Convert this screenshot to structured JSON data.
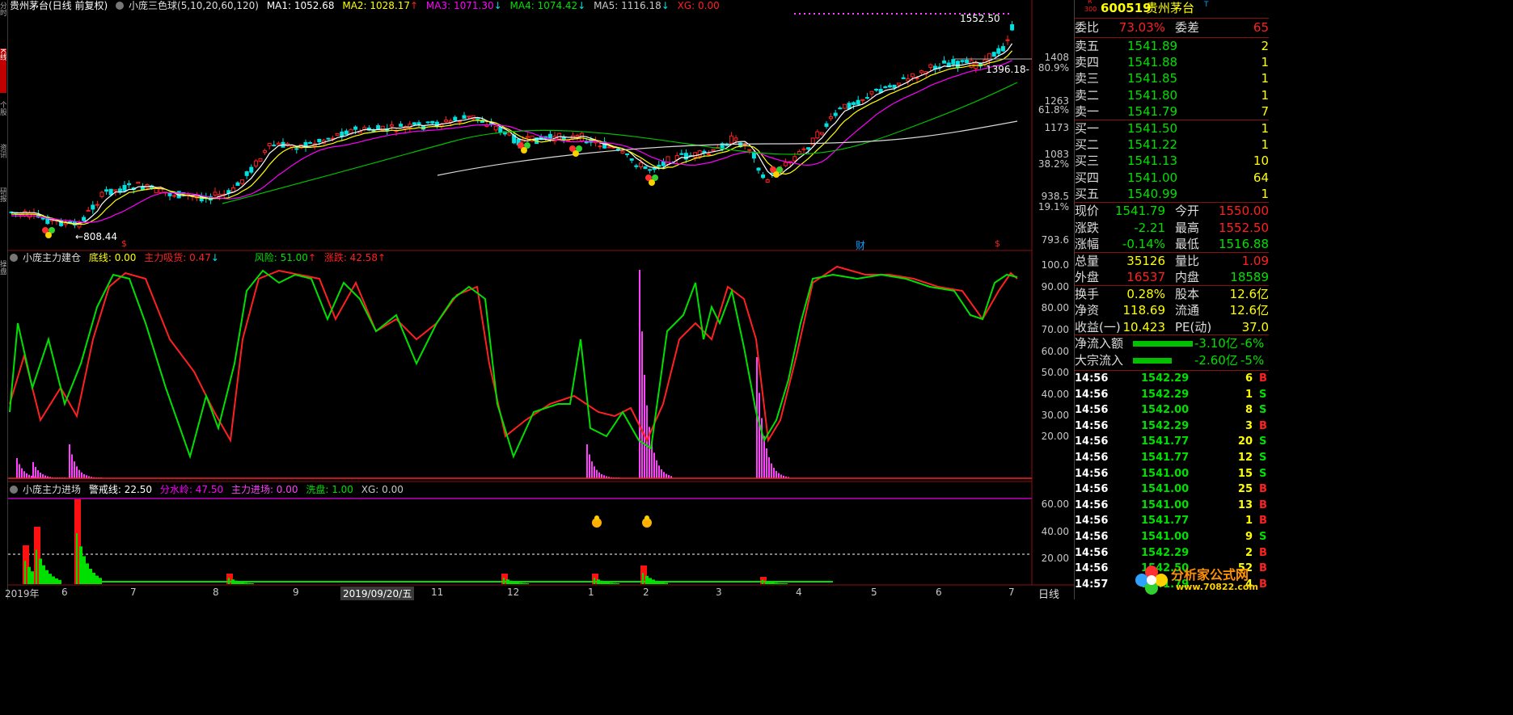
{
  "colors": {
    "up": "#ff2020",
    "down": "#00e0e0",
    "green": "#00e000",
    "yellow": "#ffff00",
    "pink": "#ff40ff",
    "magenta": "#ff00ff",
    "white": "#ffffff",
    "grey": "#c8c8c8",
    "teal": "#00a0a0"
  },
  "sidebar": {
    "tabs": [
      {
        "label": "分时",
        "icon": ""
      },
      {
        "label": "K线",
        "icon": ""
      },
      {
        "label": "个股",
        "icon": ""
      },
      {
        "label": "资讯",
        "icon": ""
      },
      {
        "label": "研报",
        "icon": ""
      },
      {
        "label": "操盘",
        "icon": ""
      }
    ]
  },
  "main": {
    "header": {
      "title": "贵州茅台(日线 前复权)",
      "indicator": "小庞三色球(5,10,20,60,120)",
      "ma1": "MA1: 1052.68",
      "ma2": "MA2: 1028.17",
      "ma3": "MA3: 1071.30",
      "ma4": "MA4: 1074.42",
      "ma5": "MA5: 1116.18",
      "xg": "XG: 0.00"
    },
    "price_axis": [
      "1408",
      "80.9%",
      "1263",
      "61.8%",
      "1173",
      "1083",
      "38.2%",
      "938.5",
      "19.1%",
      "793.6"
    ],
    "annotations": {
      "high": "1552.50",
      "low": "808.44",
      "mid": "1396.18"
    },
    "markers": {
      "fin": "财",
      "div": "$"
    }
  },
  "panel1": {
    "header": {
      "name": "小庞主力建仓",
      "a": "底线: 0.00",
      "b": "主力吸货: 0.47",
      "c": "风险: 51.00",
      "d": "涨跌: 42.58"
    },
    "axis": [
      "100.0",
      "90.00",
      "80.00",
      "70.00",
      "60.00",
      "50.00",
      "40.00",
      "30.00",
      "20.00"
    ]
  },
  "panel2": {
    "header": {
      "name": "小庞主力进场",
      "a": "警戒线: 22.50",
      "b": "分水岭: 47.50",
      "c": "主力进场: 0.00",
      "d": "洗盘: 1.00",
      "e": "XG: 0.00"
    },
    "axis": [
      "60.00",
      "40.00",
      "20.00"
    ]
  },
  "xaxis": {
    "labels": [
      "2019年",
      "6",
      "7",
      "8",
      "9",
      "2019/09/20/五",
      "11",
      "12",
      "1",
      "2",
      "3",
      "4",
      "5",
      "6",
      "7"
    ],
    "period": "日线"
  },
  "quote": {
    "code": "600519",
    "name": "贵州茅台",
    "prefix_r": "R",
    "prefix_300": "300",
    "suffix_t": "T",
    "weibi_label": "委比",
    "weibi": "73.03%",
    "weicha_label": "委差",
    "weicha": "65",
    "asks": [
      {
        "label": "卖五",
        "price": "1541.89",
        "vol": "2"
      },
      {
        "label": "卖四",
        "price": "1541.88",
        "vol": "1"
      },
      {
        "label": "卖三",
        "price": "1541.85",
        "vol": "1"
      },
      {
        "label": "卖二",
        "price": "1541.80",
        "vol": "1"
      },
      {
        "label": "卖一",
        "price": "1541.79",
        "vol": "7"
      }
    ],
    "bids": [
      {
        "label": "买一",
        "price": "1541.50",
        "vol": "1"
      },
      {
        "label": "买二",
        "price": "1541.22",
        "vol": "1"
      },
      {
        "label": "买三",
        "price": "1541.13",
        "vol": "10"
      },
      {
        "label": "买四",
        "price": "1541.00",
        "vol": "64"
      },
      {
        "label": "买五",
        "price": "1540.99",
        "vol": "1"
      }
    ],
    "stats": [
      {
        "l1": "现价",
        "v1": "1541.79",
        "l2": "今开",
        "v2": "1550.00"
      },
      {
        "l1": "涨跌",
        "v1": "-2.21",
        "l2": "最高",
        "v2": "1552.50"
      },
      {
        "l1": "涨幅",
        "v1": "-0.14%",
        "l2": "最低",
        "v2": "1516.88"
      },
      {
        "l1": "总量",
        "v1": "35126",
        "l2": "量比",
        "v2": "1.09"
      },
      {
        "l1": "外盘",
        "v1": "16537",
        "l2": "内盘",
        "v2": "18589"
      },
      {
        "l1": "换手",
        "v1": "0.28%",
        "l2": "股本",
        "v2": "12.6亿"
      },
      {
        "l1": "净资",
        "v1": "118.69",
        "l2": "流通",
        "v2": "12.6亿"
      },
      {
        "l1": "收益(一)",
        "v1": "10.423",
        "l2": "PE(动)",
        "v2": "37.0"
      }
    ],
    "flows": [
      {
        "label": "净流入额",
        "value": "-3.10亿",
        "pct": "-6%"
      },
      {
        "label": "大宗流入",
        "value": "-2.60亿",
        "pct": "-5%"
      }
    ],
    "ticks": [
      {
        "t": "14:56",
        "p": "1542.29",
        "v": "6",
        "s": "B"
      },
      {
        "t": "14:56",
        "p": "1542.29",
        "v": "1",
        "s": "S"
      },
      {
        "t": "14:56",
        "p": "1542.00",
        "v": "8",
        "s": "S"
      },
      {
        "t": "14:56",
        "p": "1542.29",
        "v": "3",
        "s": "B"
      },
      {
        "t": "14:56",
        "p": "1541.77",
        "v": "20",
        "s": "S"
      },
      {
        "t": "14:56",
        "p": "1541.77",
        "v": "12",
        "s": "S"
      },
      {
        "t": "14:56",
        "p": "1541.00",
        "v": "15",
        "s": "S"
      },
      {
        "t": "14:56",
        "p": "1541.00",
        "v": "25",
        "s": "B"
      },
      {
        "t": "14:56",
        "p": "1541.00",
        "v": "13",
        "s": "B"
      },
      {
        "t": "14:56",
        "p": "1541.77",
        "v": "1",
        "s": "B"
      },
      {
        "t": "14:56",
        "p": "1541.00",
        "v": "9",
        "s": "S"
      },
      {
        "t": "14:56",
        "p": "1542.29",
        "v": "2",
        "s": "B"
      },
      {
        "t": "14:56",
        "p": "1542.50",
        "v": "52",
        "s": "B"
      },
      {
        "t": "14:57",
        "p": "1541.79",
        "v": "4",
        "s": "B"
      }
    ]
  },
  "watermark": {
    "text": "分析家公式网",
    "url": "www.70822.com"
  }
}
